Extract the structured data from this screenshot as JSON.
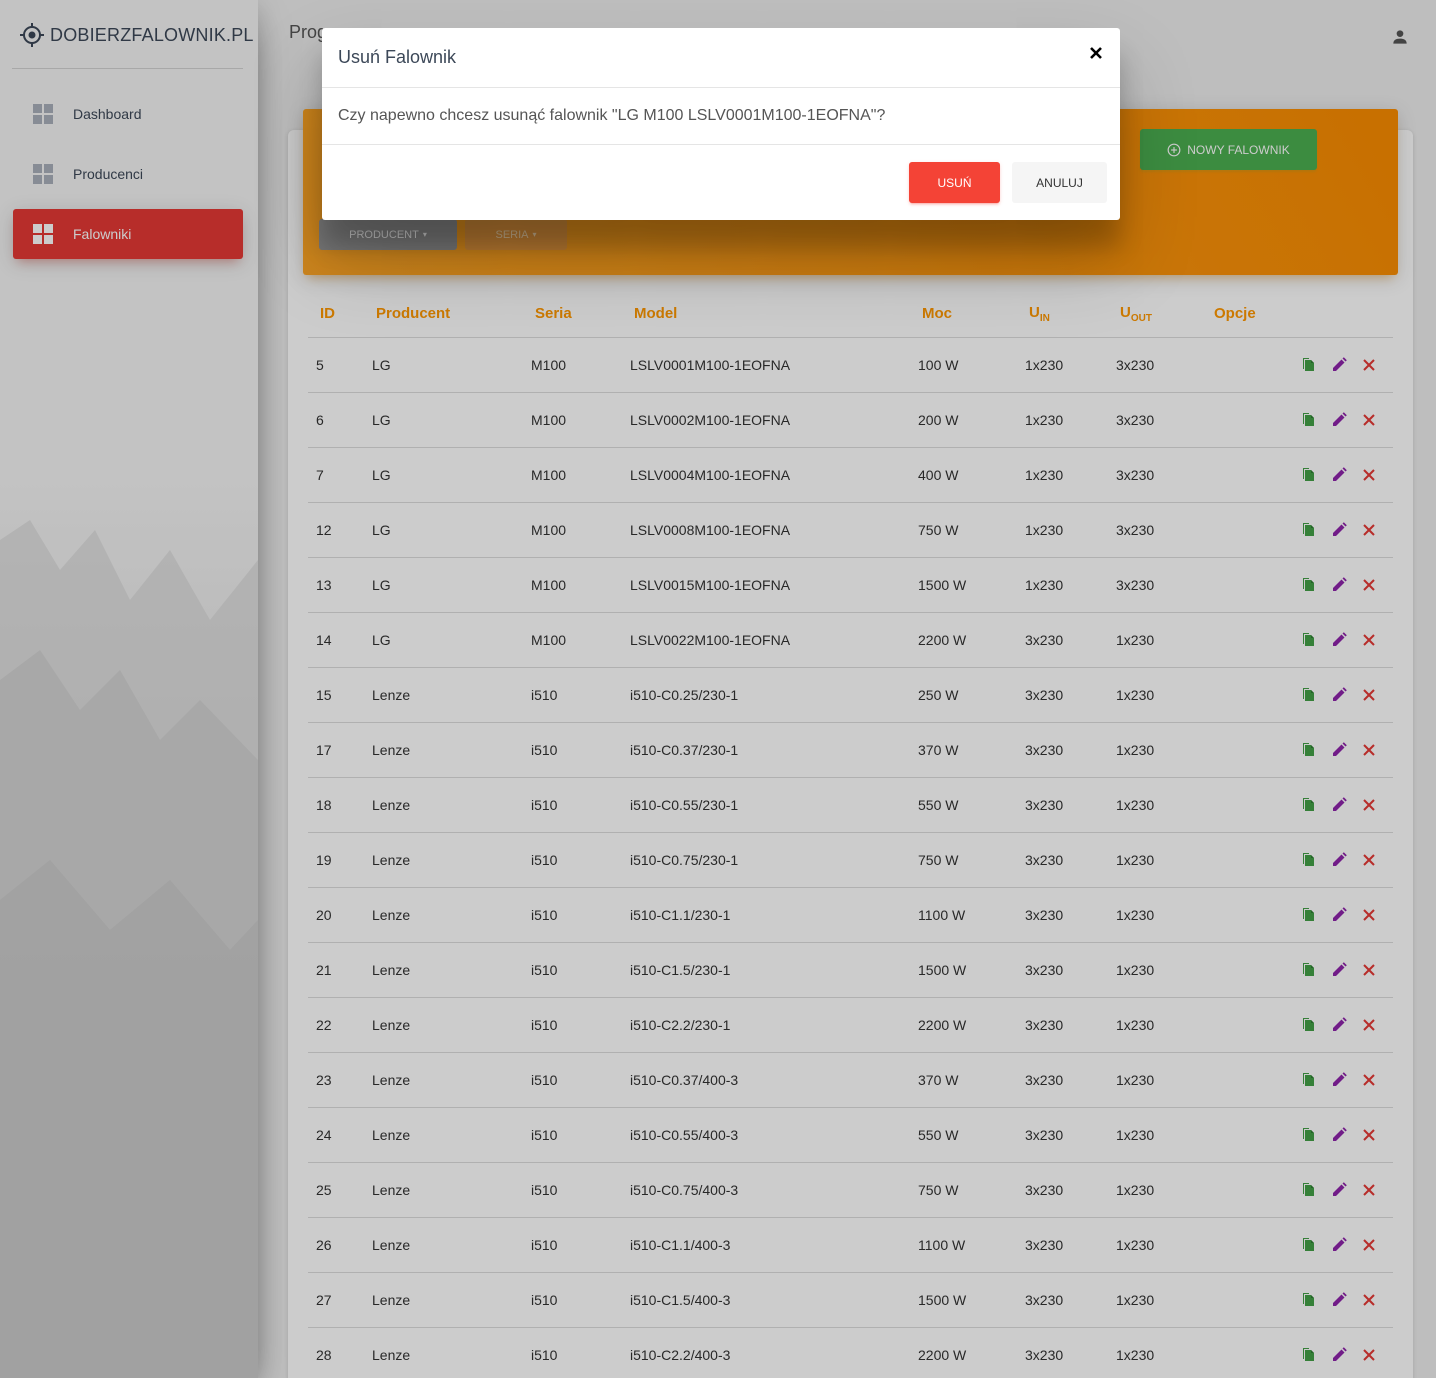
{
  "brand": {
    "name": "DOBIERZFALOWNIK.PL",
    "logo_icon": "crosshair-icon"
  },
  "sidebar": {
    "items": [
      {
        "label": "Dashboard",
        "icon": "dashboard-icon",
        "active": false
      },
      {
        "label": "Producenci",
        "icon": "dashboard-icon",
        "active": false
      },
      {
        "label": "Falowniki",
        "icon": "dashboard-icon",
        "active": true
      }
    ]
  },
  "topbar": {
    "title": "Prog",
    "user_icon": "person-icon"
  },
  "toolbar": {
    "new_button": "NOWY FALOWNIK",
    "filter_producent": "PRODUCENT",
    "filter_seria": "SERIA"
  },
  "table": {
    "headers": {
      "id": "ID",
      "producent": "Producent",
      "seria": "Seria",
      "model": "Model",
      "moc": "Moc",
      "uin_main": "U",
      "uin_sub": "IN",
      "uout_main": "U",
      "uout_sub": "OUT",
      "opcje": "Opcje"
    },
    "rows": [
      {
        "id": "5",
        "producent": "LG",
        "seria": "M100",
        "model": "LSLV0001M100-1EOFNA",
        "moc": "100 W",
        "uin": "1x230",
        "uout": "3x230"
      },
      {
        "id": "6",
        "producent": "LG",
        "seria": "M100",
        "model": "LSLV0002M100-1EOFNA",
        "moc": "200 W",
        "uin": "1x230",
        "uout": "3x230"
      },
      {
        "id": "7",
        "producent": "LG",
        "seria": "M100",
        "model": "LSLV0004M100-1EOFNA",
        "moc": "400 W",
        "uin": "1x230",
        "uout": "3x230"
      },
      {
        "id": "12",
        "producent": "LG",
        "seria": "M100",
        "model": "LSLV0008M100-1EOFNA",
        "moc": "750 W",
        "uin": "1x230",
        "uout": "3x230"
      },
      {
        "id": "13",
        "producent": "LG",
        "seria": "M100",
        "model": "LSLV0015M100-1EOFNA",
        "moc": "1500 W",
        "uin": "1x230",
        "uout": "3x230"
      },
      {
        "id": "14",
        "producent": "LG",
        "seria": "M100",
        "model": "LSLV0022M100-1EOFNA",
        "moc": "2200 W",
        "uin": "3x230",
        "uout": "1x230"
      },
      {
        "id": "15",
        "producent": "Lenze",
        "seria": "i510",
        "model": "i510-C0.25/230-1",
        "moc": "250 W",
        "uin": "3x230",
        "uout": "1x230"
      },
      {
        "id": "17",
        "producent": "Lenze",
        "seria": "i510",
        "model": "i510-C0.37/230-1",
        "moc": "370 W",
        "uin": "3x230",
        "uout": "1x230"
      },
      {
        "id": "18",
        "producent": "Lenze",
        "seria": "i510",
        "model": "i510-C0.55/230-1",
        "moc": "550 W",
        "uin": "3x230",
        "uout": "1x230"
      },
      {
        "id": "19",
        "producent": "Lenze",
        "seria": "i510",
        "model": "i510-C0.75/230-1",
        "moc": "750 W",
        "uin": "3x230",
        "uout": "1x230"
      },
      {
        "id": "20",
        "producent": "Lenze",
        "seria": "i510",
        "model": "i510-C1.1/230-1",
        "moc": "1100 W",
        "uin": "3x230",
        "uout": "1x230"
      },
      {
        "id": "21",
        "producent": "Lenze",
        "seria": "i510",
        "model": "i510-C1.5/230-1",
        "moc": "1500 W",
        "uin": "3x230",
        "uout": "1x230"
      },
      {
        "id": "22",
        "producent": "Lenze",
        "seria": "i510",
        "model": "i510-C2.2/230-1",
        "moc": "2200 W",
        "uin": "3x230",
        "uout": "1x230"
      },
      {
        "id": "23",
        "producent": "Lenze",
        "seria": "i510",
        "model": "i510-C0.37/400-3",
        "moc": "370 W",
        "uin": "3x230",
        "uout": "1x230"
      },
      {
        "id": "24",
        "producent": "Lenze",
        "seria": "i510",
        "model": "i510-C0.55/400-3",
        "moc": "550 W",
        "uin": "3x230",
        "uout": "1x230"
      },
      {
        "id": "25",
        "producent": "Lenze",
        "seria": "i510",
        "model": "i510-C0.75/400-3",
        "moc": "750 W",
        "uin": "3x230",
        "uout": "1x230"
      },
      {
        "id": "26",
        "producent": "Lenze",
        "seria": "i510",
        "model": "i510-C1.1/400-3",
        "moc": "1100 W",
        "uin": "3x230",
        "uout": "1x230"
      },
      {
        "id": "27",
        "producent": "Lenze",
        "seria": "i510",
        "model": "i510-C1.5/400-3",
        "moc": "1500 W",
        "uin": "3x230",
        "uout": "1x230"
      },
      {
        "id": "28",
        "producent": "Lenze",
        "seria": "i510",
        "model": "i510-C2.2/400-3",
        "moc": "2200 W",
        "uin": "3x230",
        "uout": "1x230"
      }
    ],
    "row_actions": [
      "copy-icon",
      "edit-icon",
      "delete-icon"
    ]
  },
  "modal": {
    "title": "Usuń Falownik",
    "message": "Czy napewno chcesz usunąć falownik \"LG M100 LSLV0001M100-1EOFNA\"?",
    "confirm_label": "USUŃ",
    "cancel_label": "ANULUJ",
    "close_icon": "close-icon"
  },
  "colors": {
    "accent_red": "#f44336",
    "sidebar_active": "#e53935",
    "header_orange": "#fb8c00",
    "success_green": "#4caf50",
    "edit_purple": "#9c27b0"
  }
}
